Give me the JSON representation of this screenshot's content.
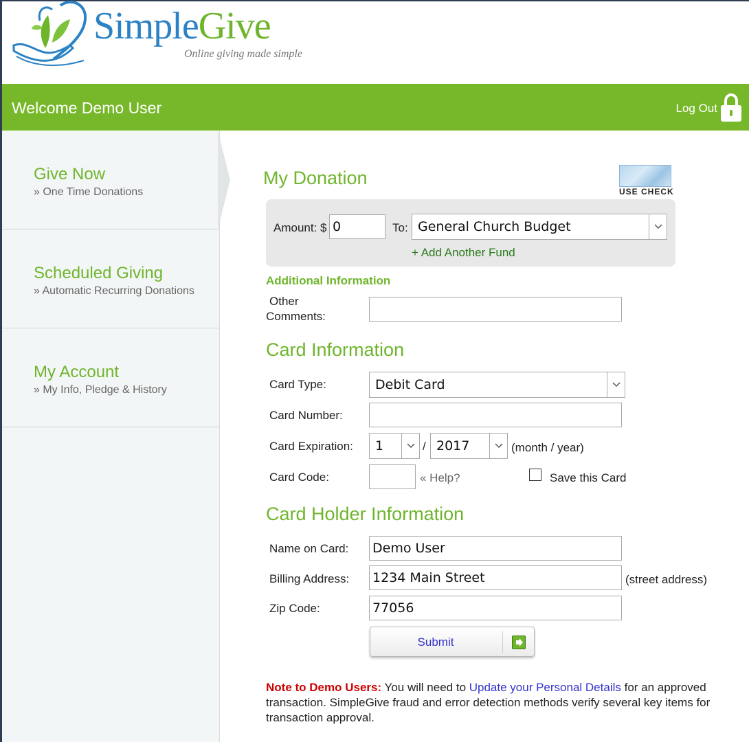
{
  "logo": {
    "name_part1": "Simple",
    "name_part2": "Give",
    "tagline": "Online giving made simple"
  },
  "header": {
    "welcome": "Welcome Demo User",
    "logout_label": "Log Out"
  },
  "sidebar": {
    "items": [
      {
        "title": "Give Now",
        "subtitle": "» One Time Donations"
      },
      {
        "title": "Scheduled Giving",
        "subtitle": "» Automatic Recurring Donations"
      },
      {
        "title": "My Account",
        "subtitle": "» My Info, Pledge & History"
      }
    ]
  },
  "donation": {
    "heading": "My Donation",
    "use_check_label": "USE CHECK",
    "amount_label": "Amount: $",
    "amount_value": "0",
    "to_label": "To:",
    "fund_selected": "General Church Budget",
    "add_fund_label": "+ Add Another Fund",
    "additional_heading": "Additional Information",
    "comments_label_1": "Other",
    "comments_label_2": "Comments:",
    "comments_value": ""
  },
  "card": {
    "heading": "Card Information",
    "type_label": "Card Type:",
    "type_selected": "Debit Card",
    "number_label": "Card Number:",
    "number_value": "",
    "expiration_label": "Card Expiration:",
    "exp_month": "1",
    "exp_separator": "/",
    "exp_year": "2017",
    "exp_hint": "(month / year)",
    "code_label": "Card Code:",
    "code_value": "",
    "help_label": "« Help?",
    "save_label": "Save this Card",
    "save_checked": false
  },
  "holder": {
    "heading": "Card Holder Information",
    "name_label": "Name on Card:",
    "name_value": "Demo User",
    "address_label": "Billing Address:",
    "address_value": "1234 Main Street",
    "address_hint": "(street address)",
    "zip_label": "Zip Code:",
    "zip_value": "77056"
  },
  "submit_label": "Submit",
  "note": {
    "prefix": "Note to Demo Users:",
    "text1": " You will need to ",
    "link": "Update your Personal Details",
    "text2": " for an approved transaction. SimpleGive fraud and error detection methods verify several key items for transaction approval."
  },
  "colors": {
    "brand_green": "#77b82a",
    "heading_green": "#6fb52c",
    "brand_blue": "#2b82c4",
    "link_blue": "#3333cc",
    "note_red": "#cc0000"
  }
}
